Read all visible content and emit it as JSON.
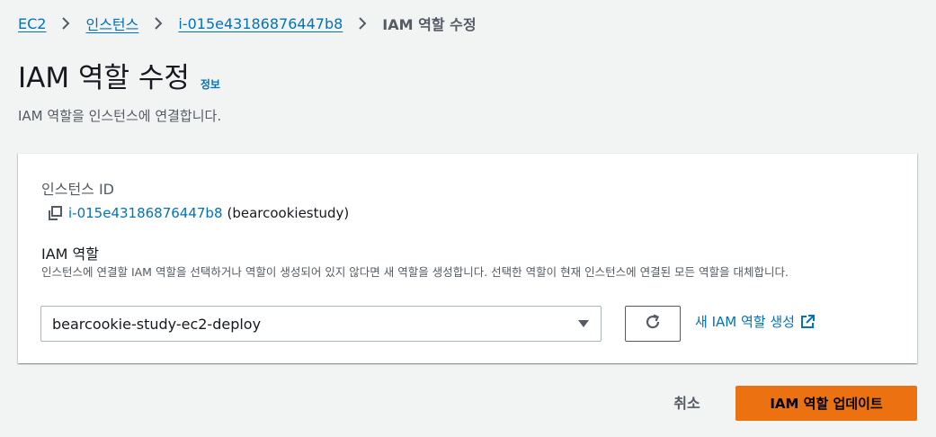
{
  "breadcrumb": {
    "items": [
      {
        "label": "EC2"
      },
      {
        "label": "인스턴스"
      },
      {
        "label": "i-015e43186876447b8"
      },
      {
        "label": "IAM 역할 수정"
      }
    ]
  },
  "header": {
    "title": "IAM 역할 수정",
    "info_link": "정보",
    "description": "IAM 역할을 인스턴스에 연결합니다."
  },
  "panel": {
    "instance_id_label": "인스턴스 ID",
    "instance_id": "i-015e43186876447b8",
    "instance_name": "(bearcookiestudy)",
    "role_label": "IAM 역할",
    "role_description": "인스턴스에 연결할 IAM 역할을 선택하거나 역할이 생성되어 있지 않다면 새 역할을 생성합니다. 선택한 역할이 현재 인스턴스에 연결된 모든 역할을 대체합니다.",
    "role_select_value": "bearcookie-study-ec2-deploy",
    "create_role_link": "새 IAM 역할 생성"
  },
  "footer": {
    "cancel_label": "취소",
    "submit_label": "IAM 역할 업데이트"
  },
  "icons": {
    "chevron": "chevron-right-icon",
    "copy": "copy-icon",
    "caret": "caret-down-icon",
    "refresh": "refresh-icon",
    "external": "external-link-icon"
  },
  "colors": {
    "link": "#0073bb",
    "primary_button": "#ec7211",
    "background": "#f2f3f3"
  }
}
